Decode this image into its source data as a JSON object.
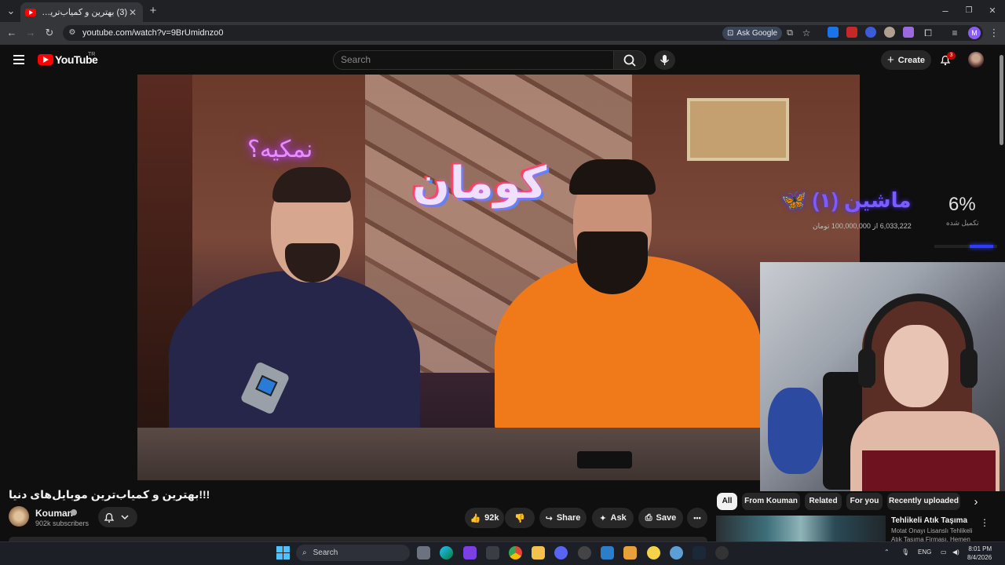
{
  "browser": {
    "tab_title": "(3) بهترین و کمیاب‌ترین موبایل‌های دنیا",
    "tab_close": "✕",
    "new_tab": "+",
    "url": "youtube.com/watch?v=9BrUmidnzo0",
    "ask_google": "Ask Google",
    "window_controls": [
      "–",
      "❐",
      "✕"
    ]
  },
  "youtube": {
    "wordmark": "YouTube",
    "region": "TR",
    "search_placeholder": "Search",
    "create_label": "Create",
    "notification_count": "3"
  },
  "video_overlay": {
    "neon_question": "نمکیه؟",
    "neon_logo": "کومان",
    "progress_title": "ماشین (۱) 🦋",
    "progress_subtitle": "6,033,222 از 100,000,000 تومان",
    "progress_percent": "6%",
    "progress_percent_label": "تکمیل شده",
    "progress_fraction": 0.06
  },
  "video_info": {
    "title": "!!!بهترین و کمیاب‌ترین موبایل‌های دنیا",
    "channel_name": "Kouman",
    "subscribers": "902k subscribers",
    "likes": "92k",
    "share_label": "Share",
    "ask_label": "Ask",
    "save_label": "Save",
    "more_label": "•••"
  },
  "chips": [
    "All",
    "From Kouman",
    "Related",
    "For you",
    "Recently uploaded"
  ],
  "recommendation": {
    "title": "Tehlikeli Atık Taşıma",
    "subtitle": "Motat Onayı Lisanslı Tehlikeli",
    "subtitle2": "Atık Taşıma Firması. Hemen"
  },
  "taskbar": {
    "search_label": "Search",
    "language": "ENG",
    "time": "8:01 PM",
    "date": "8/4/2026"
  },
  "colors": {
    "youtube_red": "#ff0000",
    "background": "#0f0f0f",
    "pill": "#272727",
    "chip_active": "#f1f1f1",
    "accent_blue": "#4cc2ff"
  }
}
